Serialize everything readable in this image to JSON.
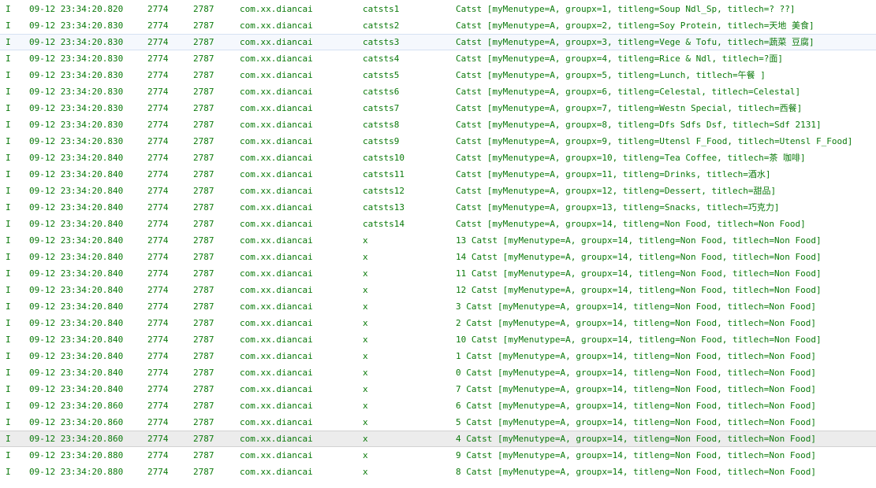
{
  "rows": [
    {
      "level": "I",
      "time": "09-12 23:34:20.820",
      "pid": "2774",
      "tid": "2787",
      "app": "com.xx.diancai",
      "tag": "catsts1",
      "text": "Catst [myMenutype=A, groupx=1, titleng=Soup Ndl_Sp, titlech=? ??]"
    },
    {
      "level": "I",
      "time": "09-12 23:34:20.830",
      "pid": "2774",
      "tid": "2787",
      "app": "com.xx.diancai",
      "tag": "catsts2",
      "text": "Catst [myMenutype=A, groupx=2, titleng=Soy Protein, titlech=天地 美食]"
    },
    {
      "level": "I",
      "time": "09-12 23:34:20.830",
      "pid": "2774",
      "tid": "2787",
      "app": "com.xx.diancai",
      "tag": "catsts3",
      "text": "Catst [myMenutype=A, groupx=3, titleng=Vege & Tofu, titlech=蔬菜 豆腐]"
    },
    {
      "level": "I",
      "time": "09-12 23:34:20.830",
      "pid": "2774",
      "tid": "2787",
      "app": "com.xx.diancai",
      "tag": "catsts4",
      "text": "Catst [myMenutype=A, groupx=4, titleng=Rice & Ndl, titlech=?面]"
    },
    {
      "level": "I",
      "time": "09-12 23:34:20.830",
      "pid": "2774",
      "tid": "2787",
      "app": "com.xx.diancai",
      "tag": "catsts5",
      "text": "Catst [myMenutype=A, groupx=5, titleng=Lunch, titlech=午餐 ]"
    },
    {
      "level": "I",
      "time": "09-12 23:34:20.830",
      "pid": "2774",
      "tid": "2787",
      "app": "com.xx.diancai",
      "tag": "catsts6",
      "text": "Catst [myMenutype=A, groupx=6, titleng=Celestal, titlech=Celestal]"
    },
    {
      "level": "I",
      "time": "09-12 23:34:20.830",
      "pid": "2774",
      "tid": "2787",
      "app": "com.xx.diancai",
      "tag": "catsts7",
      "text": "Catst [myMenutype=A, groupx=7, titleng=Westn Special, titlech=西餐]"
    },
    {
      "level": "I",
      "time": "09-12 23:34:20.830",
      "pid": "2774",
      "tid": "2787",
      "app": "com.xx.diancai",
      "tag": "catsts8",
      "text": "Catst [myMenutype=A, groupx=8, titleng=Dfs Sdfs Dsf, titlech=Sdf 2131]"
    },
    {
      "level": "I",
      "time": "09-12 23:34:20.830",
      "pid": "2774",
      "tid": "2787",
      "app": "com.xx.diancai",
      "tag": "catsts9",
      "text": "Catst [myMenutype=A, groupx=9, titleng=Utensl F_Food, titlech=Utensl F_Food]"
    },
    {
      "level": "I",
      "time": "09-12 23:34:20.840",
      "pid": "2774",
      "tid": "2787",
      "app": "com.xx.diancai",
      "tag": "catsts10",
      "text": "Catst [myMenutype=A, groupx=10, titleng=Tea Coffee, titlech=茶 咖啡]"
    },
    {
      "level": "I",
      "time": "09-12 23:34:20.840",
      "pid": "2774",
      "tid": "2787",
      "app": "com.xx.diancai",
      "tag": "catsts11",
      "text": "Catst [myMenutype=A, groupx=11, titleng=Drinks, titlech=酒水]"
    },
    {
      "level": "I",
      "time": "09-12 23:34:20.840",
      "pid": "2774",
      "tid": "2787",
      "app": "com.xx.diancai",
      "tag": "catsts12",
      "text": "Catst [myMenutype=A, groupx=12, titleng=Dessert, titlech=甜品]"
    },
    {
      "level": "I",
      "time": "09-12 23:34:20.840",
      "pid": "2774",
      "tid": "2787",
      "app": "com.xx.diancai",
      "tag": "catsts13",
      "text": "Catst [myMenutype=A, groupx=13, titleng=Snacks, titlech=巧克力]"
    },
    {
      "level": "I",
      "time": "09-12 23:34:20.840",
      "pid": "2774",
      "tid": "2787",
      "app": "com.xx.diancai",
      "tag": "catsts14",
      "text": "Catst [myMenutype=A, groupx=14, titleng=Non Food, titlech=Non Food]"
    },
    {
      "level": "I",
      "time": "09-12 23:34:20.840",
      "pid": "2774",
      "tid": "2787",
      "app": "com.xx.diancai",
      "tag": "x",
      "text": "13 Catst [myMenutype=A, groupx=14, titleng=Non Food, titlech=Non Food]"
    },
    {
      "level": "I",
      "time": "09-12 23:34:20.840",
      "pid": "2774",
      "tid": "2787",
      "app": "com.xx.diancai",
      "tag": "x",
      "text": "14 Catst [myMenutype=A, groupx=14, titleng=Non Food, titlech=Non Food]"
    },
    {
      "level": "I",
      "time": "09-12 23:34:20.840",
      "pid": "2774",
      "tid": "2787",
      "app": "com.xx.diancai",
      "tag": "x",
      "text": "11 Catst [myMenutype=A, groupx=14, titleng=Non Food, titlech=Non Food]"
    },
    {
      "level": "I",
      "time": "09-12 23:34:20.840",
      "pid": "2774",
      "tid": "2787",
      "app": "com.xx.diancai",
      "tag": "x",
      "text": "12 Catst [myMenutype=A, groupx=14, titleng=Non Food, titlech=Non Food]"
    },
    {
      "level": "I",
      "time": "09-12 23:34:20.840",
      "pid": "2774",
      "tid": "2787",
      "app": "com.xx.diancai",
      "tag": "x",
      "text": "3 Catst [myMenutype=A, groupx=14, titleng=Non Food, titlech=Non Food]"
    },
    {
      "level": "I",
      "time": "09-12 23:34:20.840",
      "pid": "2774",
      "tid": "2787",
      "app": "com.xx.diancai",
      "tag": "x",
      "text": "2 Catst [myMenutype=A, groupx=14, titleng=Non Food, titlech=Non Food]"
    },
    {
      "level": "I",
      "time": "09-12 23:34:20.840",
      "pid": "2774",
      "tid": "2787",
      "app": "com.xx.diancai",
      "tag": "x",
      "text": "10 Catst [myMenutype=A, groupx=14, titleng=Non Food, titlech=Non Food]"
    },
    {
      "level": "I",
      "time": "09-12 23:34:20.840",
      "pid": "2774",
      "tid": "2787",
      "app": "com.xx.diancai",
      "tag": "x",
      "text": "1 Catst [myMenutype=A, groupx=14, titleng=Non Food, titlech=Non Food]"
    },
    {
      "level": "I",
      "time": "09-12 23:34:20.840",
      "pid": "2774",
      "tid": "2787",
      "app": "com.xx.diancai",
      "tag": "x",
      "text": "0 Catst [myMenutype=A, groupx=14, titleng=Non Food, titlech=Non Food]"
    },
    {
      "level": "I",
      "time": "09-12 23:34:20.840",
      "pid": "2774",
      "tid": "2787",
      "app": "com.xx.diancai",
      "tag": "x",
      "text": "7 Catst [myMenutype=A, groupx=14, titleng=Non Food, titlech=Non Food]"
    },
    {
      "level": "I",
      "time": "09-12 23:34:20.860",
      "pid": "2774",
      "tid": "2787",
      "app": "com.xx.diancai",
      "tag": "x",
      "text": "6 Catst [myMenutype=A, groupx=14, titleng=Non Food, titlech=Non Food]"
    },
    {
      "level": "I",
      "time": "09-12 23:34:20.860",
      "pid": "2774",
      "tid": "2787",
      "app": "com.xx.diancai",
      "tag": "x",
      "text": "5 Catst [myMenutype=A, groupx=14, titleng=Non Food, titlech=Non Food]"
    },
    {
      "level": "I",
      "time": "09-12 23:34:20.860",
      "pid": "2774",
      "tid": "2787",
      "app": "com.xx.diancai",
      "tag": "x",
      "text": "4 Catst [myMenutype=A, groupx=14, titleng=Non Food, titlech=Non Food]"
    },
    {
      "level": "I",
      "time": "09-12 23:34:20.880",
      "pid": "2774",
      "tid": "2787",
      "app": "com.xx.diancai",
      "tag": "x",
      "text": "9 Catst [myMenutype=A, groupx=14, titleng=Non Food, titlech=Non Food]"
    },
    {
      "level": "I",
      "time": "09-12 23:34:20.880",
      "pid": "2774",
      "tid": "2787",
      "app": "com.xx.diancai",
      "tag": "x",
      "text": "8 Catst [myMenutype=A, groupx=14, titleng=Non Food, titlech=Non Food]"
    }
  ],
  "colors": {
    "info_text": "#0b7a0b",
    "selected_row_bg": "#f5f8fd",
    "hovered_row_bg": "#ececec"
  }
}
